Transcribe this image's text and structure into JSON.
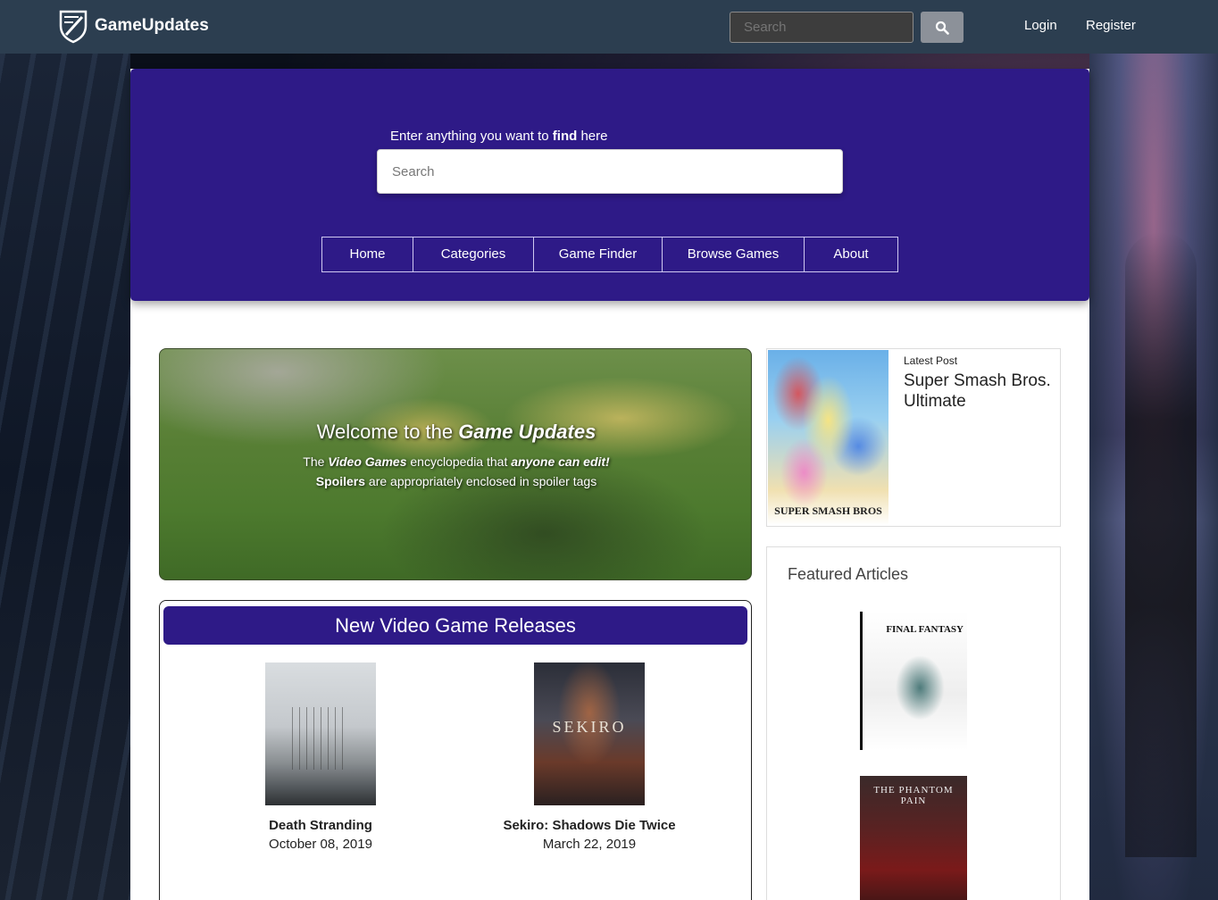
{
  "navbar": {
    "brand": "GameUpdates",
    "search_placeholder": "Search",
    "login": "Login",
    "register": "Register"
  },
  "hero": {
    "prompt_before": "Enter anything you want to ",
    "prompt_bold": "find",
    "prompt_after": " here",
    "search_placeholder": "Search",
    "nav": [
      "Home",
      "Categories",
      "Game Finder",
      "Browse Games",
      "About"
    ]
  },
  "welcome": {
    "title_before": "Welcome to the ",
    "title_em": "Game Updates",
    "line1_before": "The ",
    "line1_em1": "Video Games",
    "line1_mid": " encyclopedia that ",
    "line1_em2": "anyone can edit!",
    "line2_bold": "Spoilers",
    "line2_after": " are appropriately enclosed in spoiler tags"
  },
  "releases": {
    "header": "New Video Game Releases",
    "games": [
      {
        "title": "Death Stranding",
        "date": "October 08, 2019"
      },
      {
        "title": "Sekiro: Shadows Die Twice",
        "date": "March 22, 2019",
        "cover_text": "SEKIRO"
      }
    ]
  },
  "latest": {
    "label": "Latest Post",
    "title": "Super Smash Bros. Ultimate",
    "cover_text": "SUPER SMASH BROS"
  },
  "featured": {
    "title": "Featured Articles",
    "ff_text": "FINAL FANTASY",
    "mgs_text": "THE PHANTOM PAIN"
  },
  "colors": {
    "navbar": "#2c3e50",
    "accent": "#2e1a87"
  }
}
